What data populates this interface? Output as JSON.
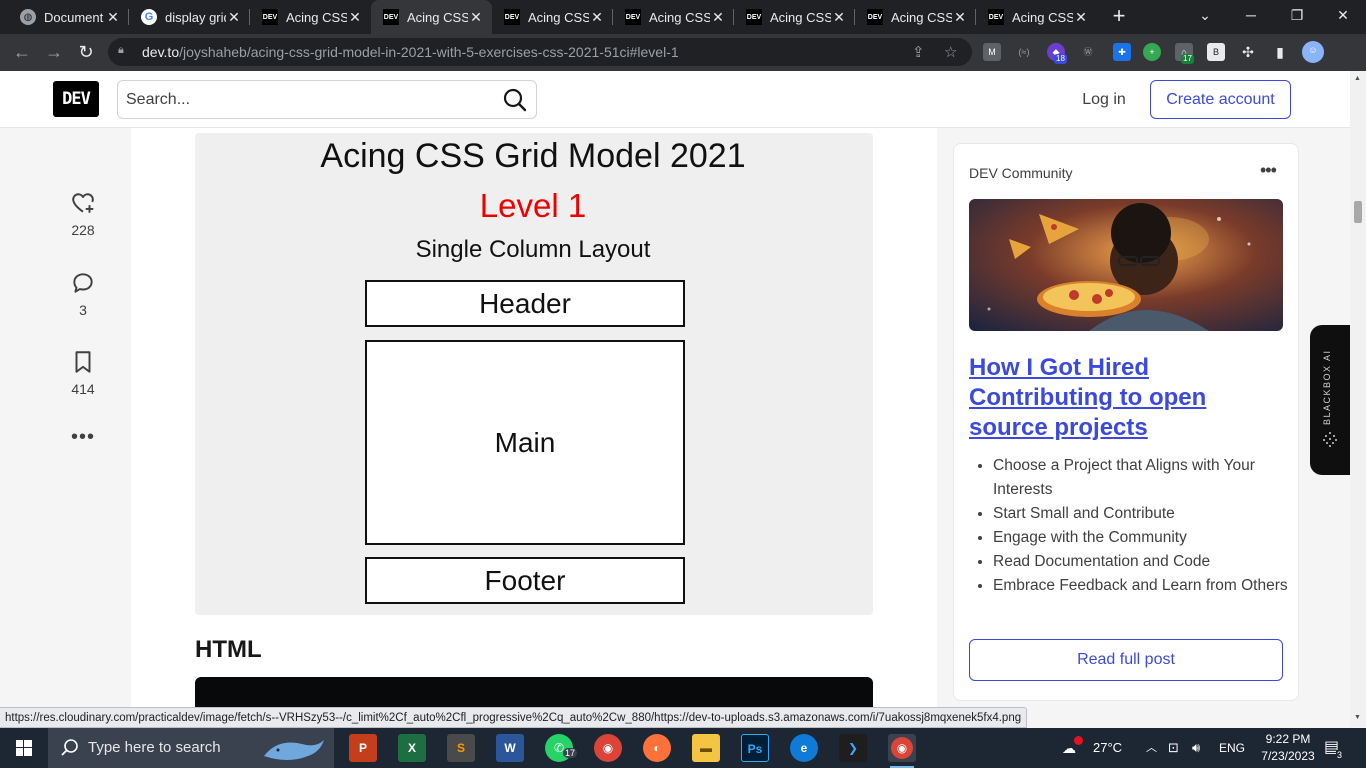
{
  "browser": {
    "tabs": [
      {
        "title": "Document",
        "favicon": "globe-icon",
        "active": false
      },
      {
        "title": "display grid",
        "favicon": "google-icon",
        "active": false
      },
      {
        "title": "Acing CSS",
        "favicon": "dev-icon",
        "active": false
      },
      {
        "title": "Acing CSS",
        "favicon": "dev-icon",
        "active": true
      },
      {
        "title": "Acing CSS",
        "favicon": "dev-icon",
        "active": false
      },
      {
        "title": "Acing CSS",
        "favicon": "dev-icon",
        "active": false
      },
      {
        "title": "Acing CSS",
        "favicon": "dev-icon",
        "active": false
      },
      {
        "title": "Acing CSS",
        "favicon": "dev-icon",
        "active": false
      },
      {
        "title": "Acing CSS",
        "favicon": "dev-icon",
        "active": false
      }
    ],
    "dev_favicon_text": "DEV",
    "url_host": "dev.to",
    "url_path": "/joyshaheb/acing-css-grid-model-in-2021-with-5-exercises-css-2021-51ci#level-1",
    "extension_badges": {
      "ext_a": "18",
      "ext_b": "17"
    }
  },
  "site": {
    "logo": "DEV",
    "search_placeholder": "Search...",
    "login_label": "Log in",
    "create_account_label": "Create account"
  },
  "reactions": {
    "likes": "228",
    "comments": "3",
    "bookmarks": "414"
  },
  "article": {
    "figure": {
      "title": "Acing CSS Grid Model 2021",
      "level": "Level 1",
      "subtitle": "Single Column Layout",
      "header_box": "Header",
      "main_box": "Main",
      "footer_box": "Footer"
    },
    "section_heading": "HTML"
  },
  "sidebar": {
    "community_label": "DEV Community",
    "post_title": "How I Got Hired Contributing to open source projects",
    "bullets": [
      "Choose a Project that Aligns with Your Interests",
      "Start Small and Contribute",
      "Engage with the Community",
      "Read Documentation and Code",
      "Embrace Feedback and Learn from Others"
    ],
    "read_full_label": "Read full post"
  },
  "blackbox": {
    "label": "BLACKBOX AI"
  },
  "status_url": "https://res.cloudinary.com/practicaldev/image/fetch/s--VRHSzy53--/c_limit%2Cf_auto%2Cfl_progressive%2Cq_auto%2Cw_880/https://dev-to-uploads.s3.amazonaws.com/i/7uakossj8mqxenek5fx4.png",
  "taskbar": {
    "search_placeholder": "Type here to search",
    "whatsapp_badge": "17",
    "weather": "27°C",
    "language": "ENG",
    "time": "9:22 PM",
    "date": "7/23/2023",
    "notifications": "3"
  },
  "colors": {
    "accent": "#3b49df",
    "level_red": "#ee0000",
    "chrome_dark": "#202124"
  }
}
